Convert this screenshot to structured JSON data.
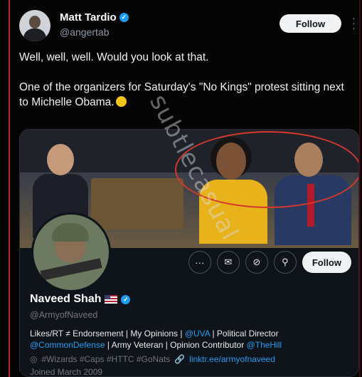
{
  "post": {
    "author_name": "Matt Tardio",
    "author_handle": "@angertab",
    "follow_label": "Follow",
    "text_line1": "Well, well, well. Would you look at that.",
    "text_line2": "One of the organizers for Saturday's \"No Kings\" protest sitting next to Michelle Obama."
  },
  "embedded_profile": {
    "name": "Naveed Shah",
    "handle": "@ArmyofNaveed",
    "follow_label": "Follow",
    "bio_part1": "Likes/RT ≠ Endorsement | My Opinions | ",
    "bio_link1": "@UVA",
    "bio_part2": " | Political Director",
    "bio_link2": "@CommonDefense",
    "bio_part3": " | Army Veteran | Opinion Contributor ",
    "bio_link3": "@TheHill",
    "hashtags": "#Wizards #Caps #HTTC #GoNats",
    "website": "linktr.ee/armyofnaveed",
    "joined": "Joined March 2009"
  },
  "icons": {
    "more": "more-icon",
    "verified": "verified-badge-icon",
    "flag": "us-flag-icon",
    "message": "message-icon",
    "notifications": "notification-bell-icon",
    "search": "search-icon"
  },
  "colors": {
    "accent": "#1d9bf0",
    "annotation": "#d2392c"
  }
}
